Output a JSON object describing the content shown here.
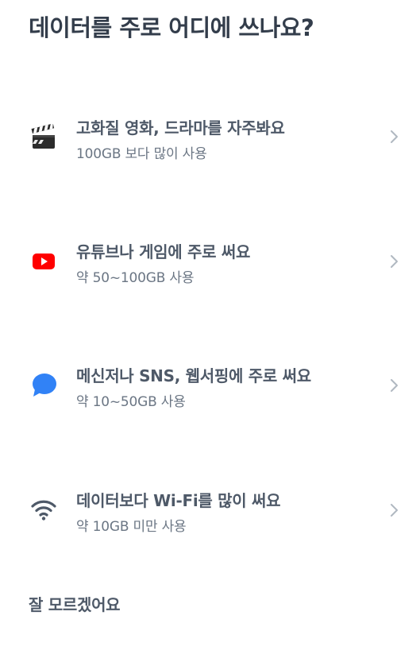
{
  "header": {
    "title": "데이터를 주로 어디에 쓰나요?"
  },
  "options": [
    {
      "icon": "clapperboard-icon",
      "title": "고화질 영화, 드라마를 자주봐요",
      "subtitle": "100GB 보다 많이 사용"
    },
    {
      "icon": "youtube-icon",
      "title": "유튜브나 게임에 주로 써요",
      "subtitle": "약 50~100GB 사용"
    },
    {
      "icon": "chat-bubble-icon",
      "title": "메신저나 SNS, 웹서핑에 주로 써요",
      "subtitle": "약 10~50GB 사용"
    },
    {
      "icon": "wifi-icon",
      "title": "데이터보다 Wi-Fi를 많이 써요",
      "subtitle": "약 10GB 미만 사용"
    }
  ],
  "unknown_label": "잘 모르겠어요",
  "colors": {
    "youtube_red": "#ff0000",
    "chat_blue": "#3182f6",
    "chevron": "#b0b8c1",
    "wifi_gray": "#4e5968"
  }
}
